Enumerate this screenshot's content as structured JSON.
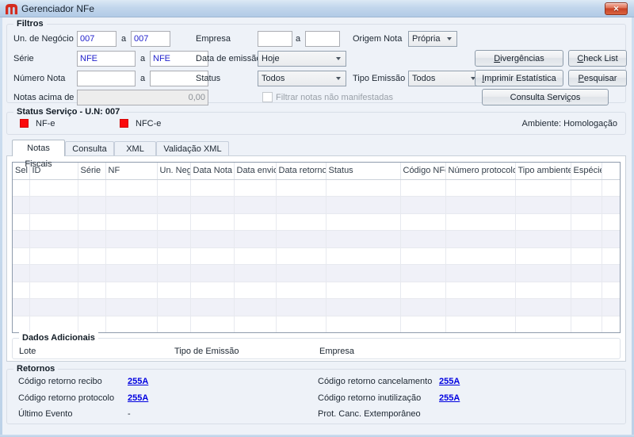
{
  "window": {
    "title": "Gerenciador NFe",
    "close_label": "✕"
  },
  "colors": {
    "status_indicator_red": "#fb0b0c",
    "link_blue": "#0000e0",
    "field_value_blue": "#2222cc",
    "titlebar_blue": "#c2d6ec"
  },
  "filtros": {
    "legend": "Filtros",
    "range_sep": "a",
    "un_negocio": {
      "label": "Un. de Negócio",
      "from": "007",
      "to": "007"
    },
    "serie": {
      "label": "Série",
      "from": "NFE",
      "to": "NFE"
    },
    "numero_nota": {
      "label": "Número Nota",
      "from": "",
      "to": ""
    },
    "notas_acima": {
      "label": "Notas acima de",
      "value": "0,00"
    },
    "empresa": {
      "label": "Empresa",
      "from": "",
      "to": ""
    },
    "data_emissao": {
      "label": "Data de emissão",
      "value": "Hoje"
    },
    "status": {
      "label": "Status",
      "value": "Todos"
    },
    "origem_nota": {
      "label": "Origem Nota",
      "value": "Própria"
    },
    "tipo_emissao": {
      "label": "Tipo Emissão",
      "value": "Todos"
    },
    "filtrar_manifestadas": "Filtrar notas não manifestadas",
    "buttons": {
      "divergencias": {
        "pre": "",
        "accel": "D",
        "post": "ivergências"
      },
      "check_list": {
        "pre": "",
        "accel": "C",
        "post": "heck List"
      },
      "imprimir_estatistica": {
        "pre": "",
        "accel": "I",
        "post": "mprimir Estatística"
      },
      "pesquisar": {
        "pre": "",
        "accel": "P",
        "post": "esquisar"
      },
      "consulta_servicos": {
        "pre": "Consulta Servi",
        "accel": "ç",
        "post": "os"
      }
    }
  },
  "status_servico": {
    "legend": "Status Serviço - U.N: 007",
    "nfe_label": "NF-e",
    "nfce_label": "NFC-e",
    "ambiente": "Ambiente: Homologação"
  },
  "tabs": [
    {
      "label": "Notas Fiscais"
    },
    {
      "label": "Consulta NFe"
    },
    {
      "label": "XML"
    },
    {
      "label": "Validação XML"
    }
  ],
  "table": {
    "columns": [
      "Sel",
      "ID",
      "Série",
      "NF",
      "Un. Neg.",
      "Data Nota",
      "Data envio",
      "Data retorno",
      "Status",
      "Código NFe",
      "Número protocolo",
      "Tipo ambiente",
      "Espécie",
      ""
    ],
    "row_count": 9
  },
  "dados_adicionais": {
    "legend": "Dados Adicionais",
    "lote_label": "Lote",
    "tipo_emissao_label": "Tipo de Emissão",
    "empresa_label": "Empresa"
  },
  "retornos": {
    "legend": "Retornos",
    "recibo": {
      "label": "Código retorno recibo",
      "value": "255A"
    },
    "protocolo": {
      "label": "Código retorno protocolo",
      "value": "255A"
    },
    "ultimo_evento": {
      "label": "Último Evento",
      "value": "-"
    },
    "cancelamento": {
      "label": "Código retorno cancelamento",
      "value": "255A"
    },
    "inutilizacao": {
      "label": "Código retorno inutilização",
      "value": "255A"
    },
    "prot_canc": {
      "label": "Prot. Canc. Extemporâneo",
      "value": ""
    }
  }
}
